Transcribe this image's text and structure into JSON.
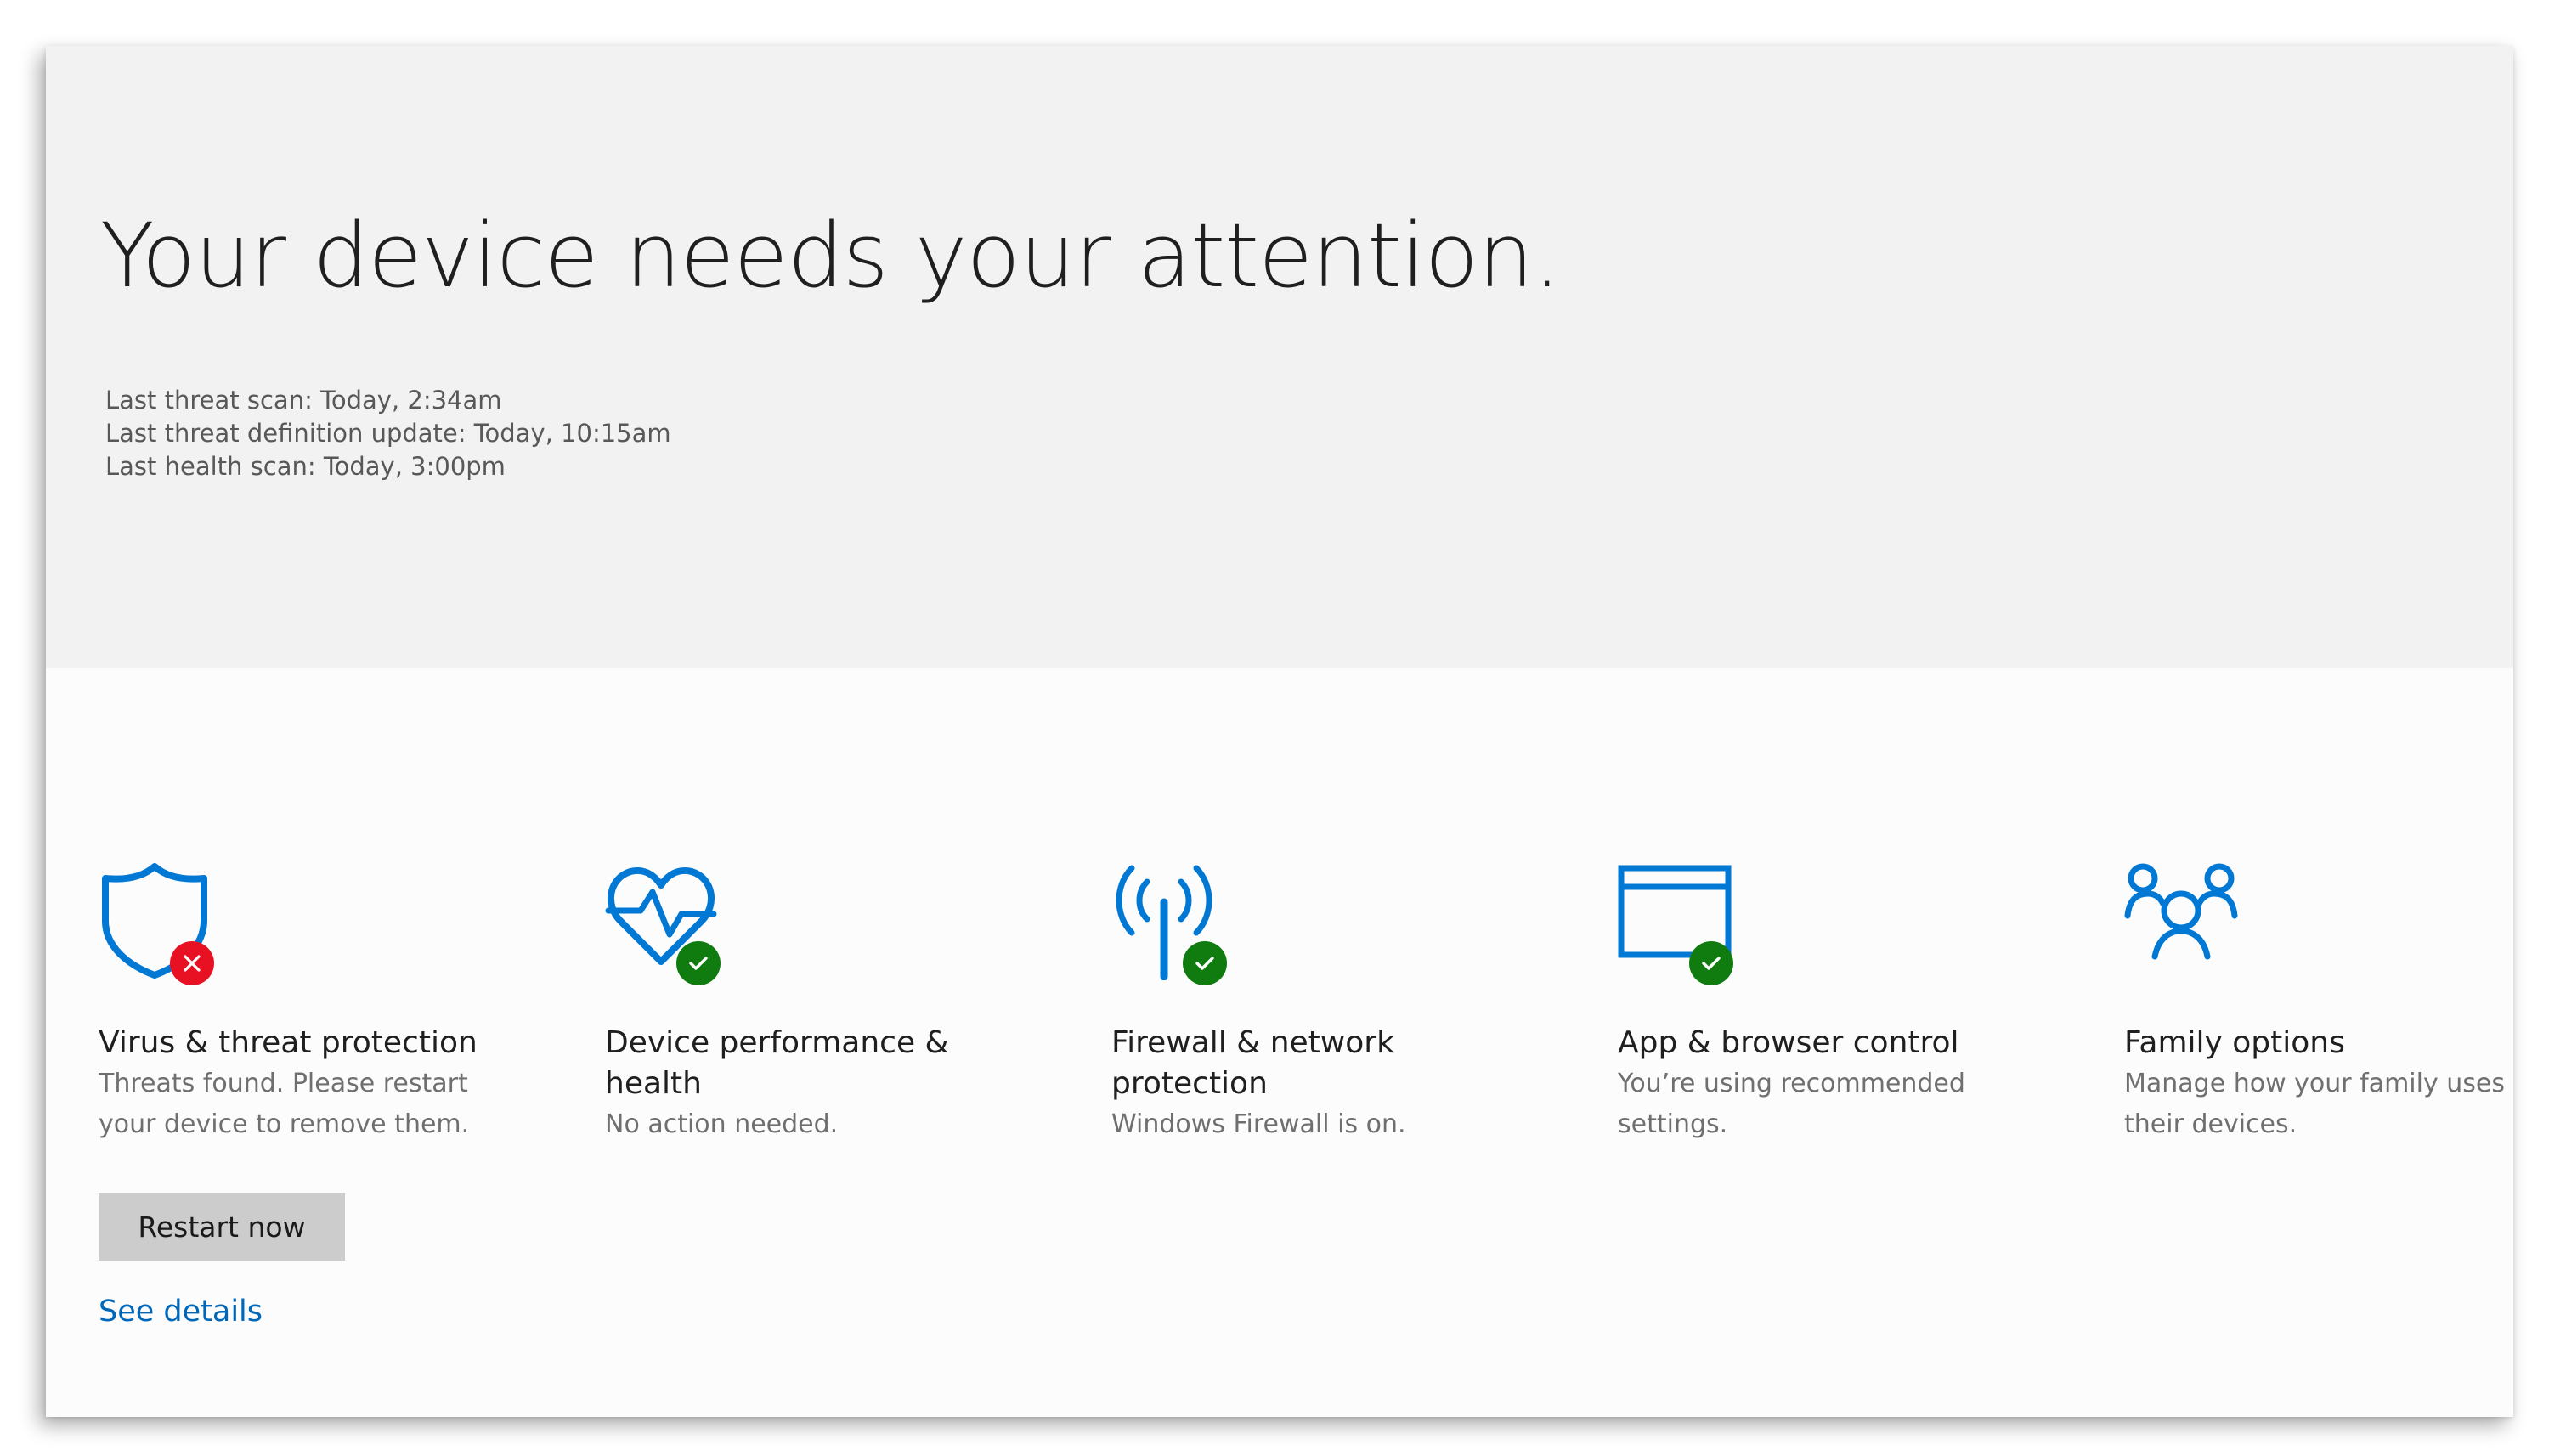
{
  "hero": {
    "title": "Your device needs your attention.",
    "scan_lines": [
      "Last threat scan: Today, 2:34am",
      "Last threat definition update: Today, 10:15am",
      "Last health scan: Today, 3:00pm"
    ]
  },
  "cards": [
    {
      "icon": "shield-icon",
      "badge": "error-x",
      "title": "Virus & threat protection",
      "description": "Threats found. Please restart your device to remove them."
    },
    {
      "icon": "heart-pulse-icon",
      "badge": "ok-check",
      "title": "Device performance & health",
      "description": "No action needed."
    },
    {
      "icon": "wireless-antenna-icon",
      "badge": "ok-check",
      "title": "Firewall & network protection",
      "description": "Windows Firewall is on."
    },
    {
      "icon": "browser-window-icon",
      "badge": "ok-check",
      "title": "App & browser control",
      "description": "You’re using recommended settings."
    },
    {
      "icon": "family-icon",
      "badge": "",
      "title": "Family options",
      "description": "Manage how your family uses their devices."
    }
  ],
  "actions": {
    "restart_label": "Restart now",
    "details_label": "See details"
  },
  "colors": {
    "icon_blue": "#0078d4",
    "ok_green": "#107c10",
    "error_red": "#e81123",
    "link_blue": "#0067b8",
    "hero_bg": "#f2f2f2",
    "button_bg": "#cccccc"
  }
}
